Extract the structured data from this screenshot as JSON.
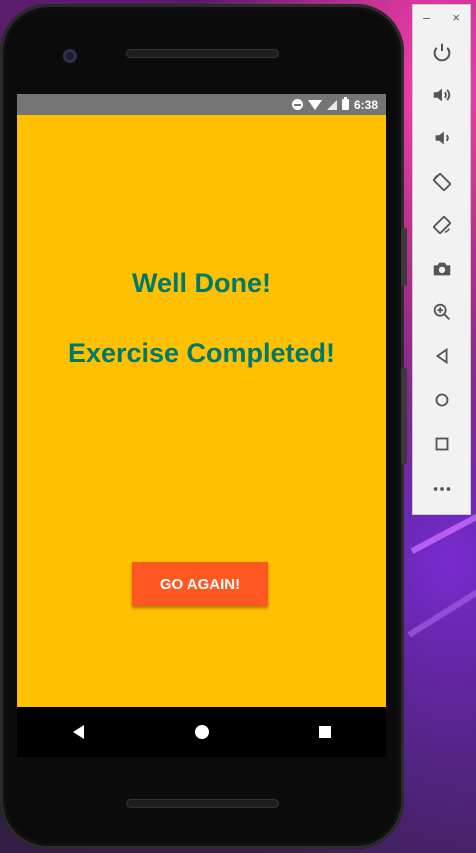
{
  "status_bar": {
    "time": "6:38"
  },
  "app": {
    "message_line1": "Well Done!",
    "message_line2": "Exercise Completed!",
    "go_again_label": "GO AGAIN!"
  },
  "colors": {
    "screen_bg": "#FFC000",
    "message_text": "#00796B",
    "button_bg": "#FF5722",
    "status_bar_bg": "#757575"
  },
  "emulator_toolbar": {
    "window_minimize": "–",
    "window_close": "×",
    "items": [
      "power-icon",
      "volume-up-icon",
      "volume-down-icon",
      "rotate-left-icon",
      "rotate-right-icon",
      "camera-icon",
      "zoom-icon",
      "back-icon",
      "home-icon",
      "overview-icon",
      "more-icon"
    ]
  }
}
